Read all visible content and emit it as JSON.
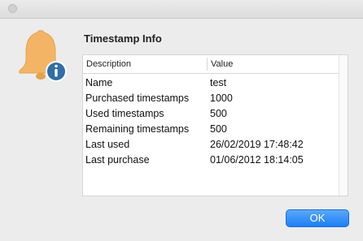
{
  "dialog": {
    "title": "Timestamp Info",
    "icon": "bell-info-icon",
    "ok_label": "OK",
    "accent_color": "#1d7ff5"
  },
  "table": {
    "headers": {
      "description": "Description",
      "value": "Value"
    },
    "rows": [
      {
        "description": "Name",
        "value": "test"
      },
      {
        "description": "Purchased timestamps",
        "value": "1000"
      },
      {
        "description": "Used timestamps",
        "value": "500"
      },
      {
        "description": "Remaining timestamps",
        "value": "500"
      },
      {
        "description": "Last used",
        "value": "26/02/2019 17:48:42"
      },
      {
        "description": "Last purchase",
        "value": "01/06/2012 18:14:05"
      }
    ]
  }
}
